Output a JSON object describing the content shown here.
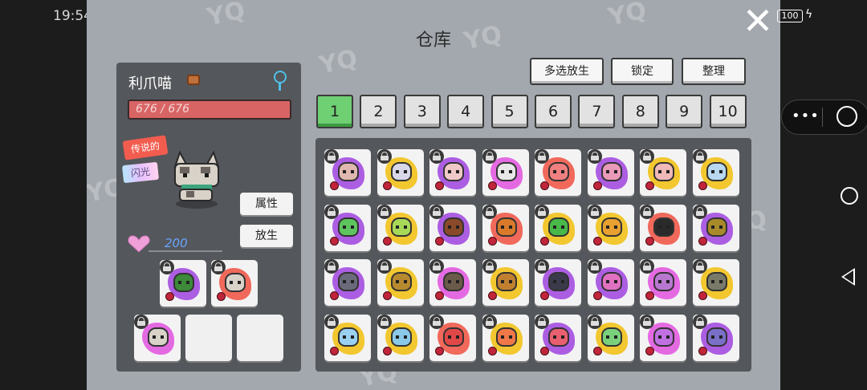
{
  "statusbar": {
    "time": "19:54",
    "battery": "100"
  },
  "title": "仓库",
  "pet": {
    "name": "利爪喵",
    "hp": "676 / 676",
    "tag_rarity": "传说的",
    "tag_shiny": "闪光",
    "affection": "200",
    "btn_attributes": "属性",
    "btn_release": "放生"
  },
  "toolbar": {
    "multi_release": "多选放生",
    "lock": "锁定",
    "sort": "整理"
  },
  "pages": [
    "1",
    "2",
    "3",
    "4",
    "5",
    "6",
    "7",
    "8",
    "9",
    "10"
  ],
  "active_page": "1",
  "colors": {
    "accent_green": "#6fcf73",
    "hp_red": "#d86464",
    "panel": "#54575b",
    "background": "#a3a8ae"
  },
  "icons": [
    "close-icon",
    "bag-icon",
    "gender-icon",
    "heart-icon",
    "lock-icon",
    "berry-icon"
  ]
}
